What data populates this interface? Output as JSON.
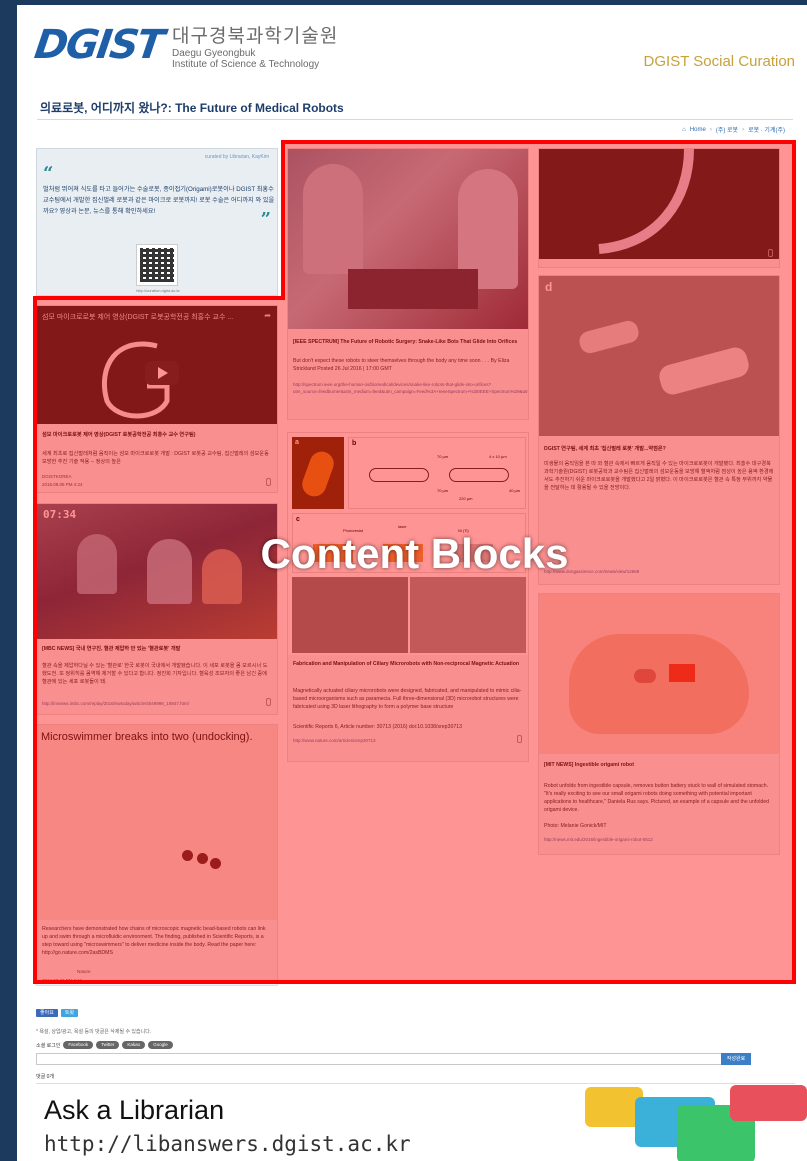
{
  "header": {
    "logo_mark": "DGIST",
    "logo_korean": "대구경북과학기술원",
    "logo_english_line1": "Daegu Gyeongbuk",
    "logo_english_line2": "Institute of Science & Technology",
    "site_title": "DGIST Social Curation"
  },
  "page_title": "의료로봇, 어디까지 왔나?: The Future of Medical Robots",
  "breadcrumb": [
    "Home",
    "(주) 로봇",
    "로봇 · 기계(주)"
  ],
  "curator": {
    "curated_by": "curated by Librarian, KayKim",
    "text": "벌처럼 뛰어져 식도를 타고 들어가는 수술로봇, 종이접기(Origami)로봇이나 DGIST 최홍수 교수팀에서 개발한 집신벌레 로봇과 같은 마이크로 로봇까지! 로봇 수술은 어디까지 와 있을까요? 영상과 논문, 뉴스를 통해 확인하세요!",
    "qr_caption": "http://curation.dgist.ac.kr"
  },
  "blocks": {
    "video1": {
      "video_title": "섬모 마이크로로봇 제어 영상(DGIST 로봇공학전공 최홍수 교수 ...",
      "title": "섬모 마이크로로봇 제어 영상(DGIST 로봇공학전공 최홍수 교수 연구팀)",
      "body": "세계 최초로 집신벌레처럼 움직이는 섬모 마이크로로봇 개발 : DGIST 로봇공 교수팀, 집신벌레의 섬모운동 모방한 추진 기술 적용 -- 정상의 높은",
      "source": "DGISTKOREA",
      "date": "2016.08.05 PM 4:24"
    },
    "video2": {
      "clock": "07:34",
      "title": "[MBC NEWS] 국내 연구진, 혈관 제압하 안 있는 '혈관로봇' 개발",
      "body": "혈관 속을 제압하다닐 수 있는 '혈관로' 한국 로봇이 국내에서 개발됐습니다. 이 세포 로봇을 몸 모르시너 도했도전. 또 정위히를 몸역해 제거할 수 있다고 합니다. 정진희 기자입니다. 혈육성 조보자의 좋은 남긴 중에 혈관에 있는 세포 로봇들이 돼.",
      "link": "http://imnews.imbc.com/replay/2016/nwtoday/article/4049998_19847.html"
    },
    "video3": {
      "overlay_title": "Microswimmer breaks into two (undocking).",
      "body": "Researchers have demonstrated how chains of microscopic magnetic bead-based robots can link up and swim through a microfluidic environment. The finding, published in Scientific Reports, is a step toward using \"microswimmers\" to deliver medicine inside the body. Read the paper here: http://go.nature.com/2asBDMS",
      "source": "Nature",
      "date": "2016.07.28 PM 6:11"
    },
    "spectrum": {
      "title": "[IEEE SPECTRUM] The Future of Robotic Surgery: Snake-Like Bots That Glide Into Orifices",
      "body": "But don't expect these robots to steer themselves through the body any time soon . . . By Eliza Strickland Posted 26 Jul 2016 | 17:00 GMT",
      "link": "http://spectrum.ieee.org/the-human-os/biomedical/devices/snake-like-robots-that-glide-into-orifices?utm_source=feedburner&utm_medium=feed&utm_campaign=Feed%3A+IeeeSpectrum+%28IEEE+Spectrum%29&utm_content=FaceBook"
    },
    "microrobots": {
      "title": "Fabrication and Manipulation of Ciliary Microrobots with Non-reciprocal Magnetic Actuation",
      "body": "Magnetically actuated ciliary microrobots were designed, fabricated, and manipulated to mimic cilia-based microorganisms such as paramecia. Full three-dimensional (3D) microrobot structures were fabricated using 3D laser lithography to form a polymer base structure",
      "citation": "Scientific Reports 6, Article number: 30713 (2016) doi:10.1038/srep30713",
      "link": "http://www.nature.com/articles/srep30713"
    },
    "dgist_robot": {
      "title": "DGIST 연구팀, 세계 최초 '집신벌레 로봇' 개발...약점은?",
      "body": "미생물의 움직임을 본 따 와 혈관 속에서 빠르게 움직일 수 있는 마이크로로봇이 개발됐다. 최홍수 대구경북과학기술원(DGIST) 로봇공학과 교수팀은 집신벌레의 섬모운동을 모방해 혈액처럼 점성이 높은 용액 환경에서도 추진하기 쉬운 마이크로로봇을 개발했다고 2일 밝혔다. 이 마이크로로봇은 혈관 속 특정 부위까지 약물을 전달하는 데 활용될 수 있을 전망이다.",
      "link": "http://www.dongascience.com/news/view/12669"
    },
    "origami": {
      "title": "[MIT NEWS] Ingestible origami robot",
      "body": "Robot unfolds from ingestible capsule, removes button battery stuck to wall of simulated stomach. \"It's really exciting to see our small origami robots doing something with potential important applications to healthcare,\" Daniela Rus says. Pictured, an example of a capsule and the unfolded origami device.",
      "photo": "Photo: Melanie Gonick/MIT",
      "link": "http://news.mit.edu/2016/ingestible-origami-robot-0512"
    }
  },
  "figure_labels": {
    "a": "a",
    "b": "b",
    "c": "c",
    "d": "d",
    "dim1": "70 µm",
    "dim2": "4 x 10 µm",
    "dim3": "40 µm",
    "dim4": "70 µm",
    "dim5": "220 µm",
    "photoresist": "Photoresist",
    "laser": "laser",
    "ni": "Ni (Ti)"
  },
  "overlay": {
    "label": "Content Blocks",
    "color": "#ff0000"
  },
  "comments": {
    "share_fb": "좋아요",
    "share_tw": "트윗",
    "notice": "* 욕설, 상업/광고, 욕설 등의 댓글은 삭제될 수 있습니다.",
    "social_label": "소셜 로그인",
    "social_buttons": [
      "Facebook",
      "Twitter",
      "Kakao",
      "Google"
    ],
    "submit": "작성완료",
    "count": "댓글 0개"
  },
  "ask": {
    "title": "Ask a Librarian",
    "url": "http://libanswers.dgist.ac.kr"
  }
}
